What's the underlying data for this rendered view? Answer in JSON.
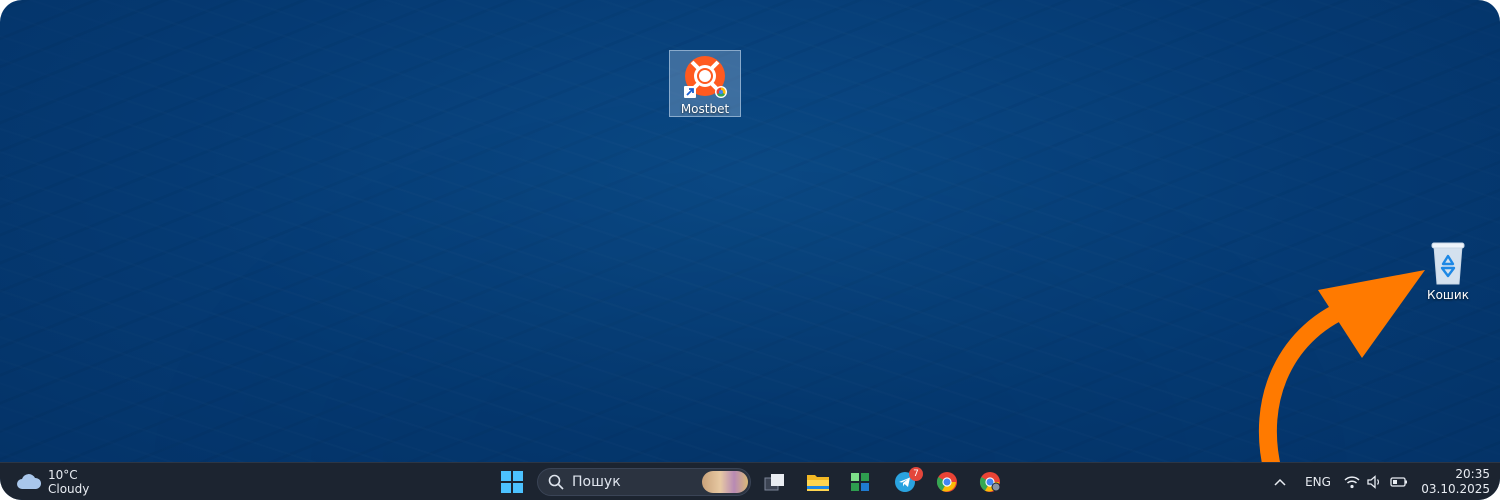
{
  "desktop": {
    "icons": [
      {
        "label": "Mostbet",
        "icon": "mostbet-lifebuoy-icon"
      },
      {
        "label": "Кошик",
        "icon": "recycle-bin-icon"
      }
    ],
    "annotation": {
      "type": "arrow",
      "color": "#ff7a00"
    }
  },
  "taskbar": {
    "weather": {
      "temperature": "10°C",
      "condition": "Cloudy",
      "icon": "cloud-icon"
    },
    "search": {
      "placeholder": "Пошук",
      "icon": "search-icon"
    },
    "apps": [
      {
        "name": "start",
        "icon": "windows-logo-icon"
      },
      {
        "name": "task-view",
        "icon": "task-view-icon"
      },
      {
        "name": "file-explorer",
        "icon": "folder-icon"
      },
      {
        "name": "app-green",
        "icon": "green-app-icon"
      },
      {
        "name": "telegram",
        "icon": "telegram-icon",
        "badge": "7"
      },
      {
        "name": "chrome",
        "icon": "chrome-icon"
      },
      {
        "name": "chrome-profile",
        "icon": "chrome-icon"
      }
    ],
    "tray": {
      "language": "ENG",
      "icons": [
        "chevron-up-icon",
        "wifi-icon",
        "volume-icon",
        "battery-icon"
      ]
    },
    "clock": {
      "time": "20:35",
      "date": "03.10.2025"
    }
  }
}
